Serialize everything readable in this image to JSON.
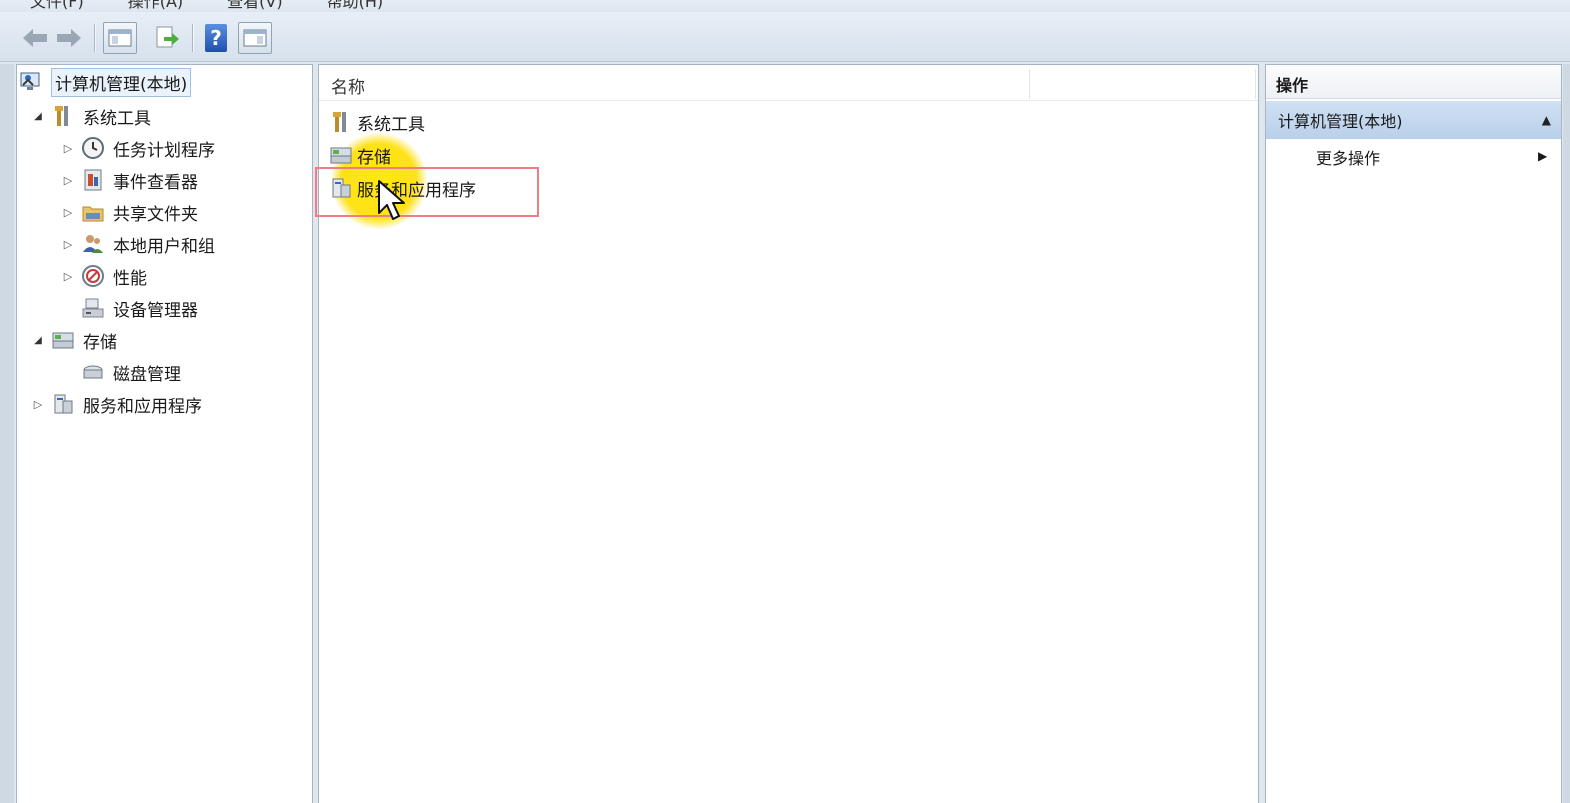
{
  "menu": {
    "items": [
      "文件(F)",
      "操作(A)",
      "查看(V)",
      "帮助(H)"
    ]
  },
  "toolbar": {
    "back": "arrow-left-icon",
    "forward": "arrow-right-icon",
    "show_hide_tree": "console-tree-icon",
    "export": "export-list-icon",
    "help_glyph": "?",
    "show_hide_action": "action-pane-icon"
  },
  "tree": {
    "root": "计算机管理(本地)",
    "system_tools": "系统工具",
    "task_scheduler": "任务计划程序",
    "event_viewer": "事件查看器",
    "shared_folders": "共享文件夹",
    "local_users": "本地用户和组",
    "performance": "性能",
    "device_manager": "设备管理器",
    "storage": "存储",
    "disk_management": "磁盘管理",
    "services_apps": "服务和应用程序"
  },
  "list": {
    "column_name": "名称",
    "items": [
      "系统工具",
      "存储",
      "服务和应用程序"
    ]
  },
  "actions": {
    "title": "操作",
    "section": "计算机管理(本地)",
    "more": "更多操作"
  },
  "colors": {
    "accent_selection": "#b9d0ea",
    "highlight_box": "#f07d86",
    "cursor_spot": "#ffe400"
  }
}
